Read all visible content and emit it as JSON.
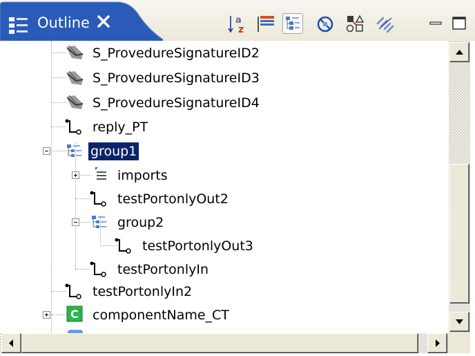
{
  "view": {
    "title": "Outline",
    "icon": "outline-view-icon",
    "close_icon": "close-icon"
  },
  "toolbar": [
    {
      "name": "sort-alphabetically-button",
      "icon": "sort-az-icon",
      "selected": false
    },
    {
      "name": "collapse-all-button",
      "icon": "collapse-all-icon",
      "selected": false
    },
    {
      "name": "show-groups-button",
      "icon": "group-tree-icon",
      "selected": true
    },
    {
      "name": "hide-non-public-button",
      "icon": "filter-hide-icon",
      "selected": false
    },
    {
      "name": "show-dependencies-button",
      "icon": "shapes-icon",
      "selected": false
    },
    {
      "name": "link-with-editor-button",
      "icon": "link-icon",
      "selected": false
    },
    {
      "name": "minimize-button",
      "icon": "minimize-icon",
      "selected": false
    },
    {
      "name": "maximize-button",
      "icon": "maximize-icon",
      "selected": false
    }
  ],
  "tree": [
    {
      "label": "S_ProvedureSignatureID2",
      "icon": "signature-icon",
      "level": 1
    },
    {
      "label": "S_ProvedureSignatureID3",
      "icon": "signature-icon",
      "level": 1
    },
    {
      "label": "S_ProvedureSignatureID4",
      "icon": "signature-icon",
      "level": 1
    },
    {
      "label": "reply_PT",
      "icon": "port-type-icon",
      "level": 1
    },
    {
      "label": "group1",
      "icon": "group-icon",
      "level": 1,
      "expander": "minus",
      "selected": true
    },
    {
      "label": "imports",
      "icon": "imports-icon",
      "level": 2,
      "expander": "plus"
    },
    {
      "label": "testPortonlyOut2",
      "icon": "port-type-icon",
      "level": 2
    },
    {
      "label": "group2",
      "icon": "group-icon",
      "level": 2,
      "expander": "minus"
    },
    {
      "label": "testPortonlyOut3",
      "icon": "port-type-icon",
      "level": 3
    },
    {
      "label": "testPortonlyIn",
      "icon": "port-type-icon",
      "level": 2
    },
    {
      "label": "testPortonlyIn2",
      "icon": "port-type-icon",
      "level": 1
    },
    {
      "label": "componentName_CT",
      "icon": "component-type-icon",
      "level": 1,
      "expander": "plus"
    }
  ],
  "scroll": {
    "vertical_position": 0.55,
    "horizontal_position": 0.0
  },
  "colors": {
    "tab_active": "#2a5bb8",
    "selection": "#0a246a",
    "chrome": "#ece9d8"
  }
}
